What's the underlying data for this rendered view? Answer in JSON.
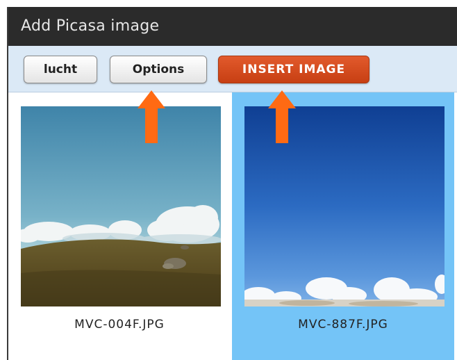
{
  "window": {
    "title": "Add Picasa image"
  },
  "toolbar": {
    "lucht_label": "lucht",
    "options_label": "Options",
    "insert_label": "INSERT IMAGE"
  },
  "gallery": {
    "items": [
      {
        "filename": "MVC-004F.JPG",
        "selected": false
      },
      {
        "filename": "MVC-887F.JPG",
        "selected": true
      }
    ]
  },
  "colors": {
    "titlebar": "#2b2b2b",
    "toolbar": "#dbe9f6",
    "accent_button": "#d24a1c",
    "selection": "#74c4f7",
    "annotation_arrow": "#ff6a13"
  },
  "icons": {
    "annotation_arrow": "up-arrow-icon"
  }
}
